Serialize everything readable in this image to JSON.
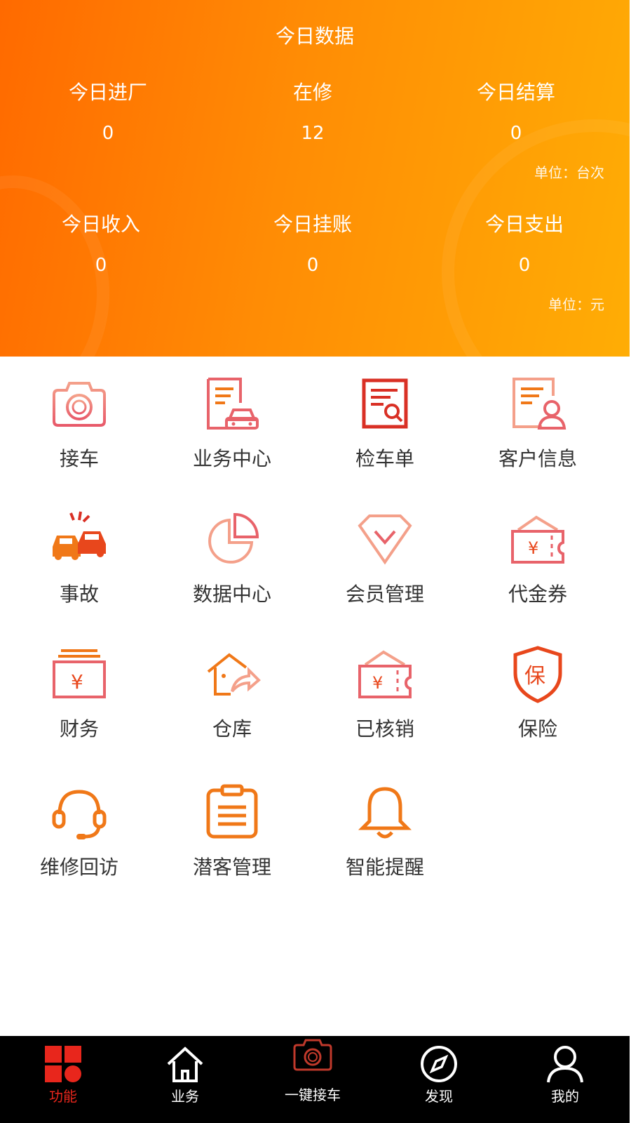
{
  "header": {
    "title": "今日数据",
    "row1": [
      {
        "label": "今日进厂",
        "value": "0"
      },
      {
        "label": "在修",
        "value": "12"
      },
      {
        "label": "今日结算",
        "value": "0"
      }
    ],
    "row1_unit": "单位：台次",
    "row2": [
      {
        "label": "今日收入",
        "value": "0"
      },
      {
        "label": "今日挂账",
        "value": "0"
      },
      {
        "label": "今日支出",
        "value": "0"
      }
    ],
    "row2_unit": "单位：元"
  },
  "grid": [
    {
      "label": "接车",
      "icon": "camera-icon"
    },
    {
      "label": "业务中心",
      "icon": "document-car-icon"
    },
    {
      "label": "检车单",
      "icon": "inspection-form-icon"
    },
    {
      "label": "客户信息",
      "icon": "customer-card-icon"
    },
    {
      "label": "事故",
      "icon": "car-crash-icon"
    },
    {
      "label": "数据中心",
      "icon": "pie-chart-icon"
    },
    {
      "label": "会员管理",
      "icon": "diamond-icon"
    },
    {
      "label": "代金券",
      "icon": "voucher-icon"
    },
    {
      "label": "财务",
      "icon": "yuan-box-icon"
    },
    {
      "label": "仓库",
      "icon": "warehouse-icon"
    },
    {
      "label": "已核销",
      "icon": "ticket-icon"
    },
    {
      "label": "保险",
      "icon": "shield-bao-icon"
    },
    {
      "label": "维修回访",
      "icon": "headset-icon"
    },
    {
      "label": "潜客管理",
      "icon": "clipboard-icon"
    },
    {
      "label": "智能提醒",
      "icon": "bell-icon"
    }
  ],
  "tabbar": [
    {
      "label": "功能",
      "icon": "grid-apps-icon",
      "active": true
    },
    {
      "label": "业务",
      "icon": "home-icon",
      "active": false
    },
    {
      "label": "一键接车",
      "icon": "camera-icon",
      "active": false
    },
    {
      "label": "发现",
      "icon": "compass-icon",
      "active": false
    },
    {
      "label": "我的",
      "icon": "user-icon",
      "active": false
    }
  ],
  "colors": {
    "accent": "#e8261c",
    "orange": "#f07818",
    "pink": "#e8636a"
  }
}
